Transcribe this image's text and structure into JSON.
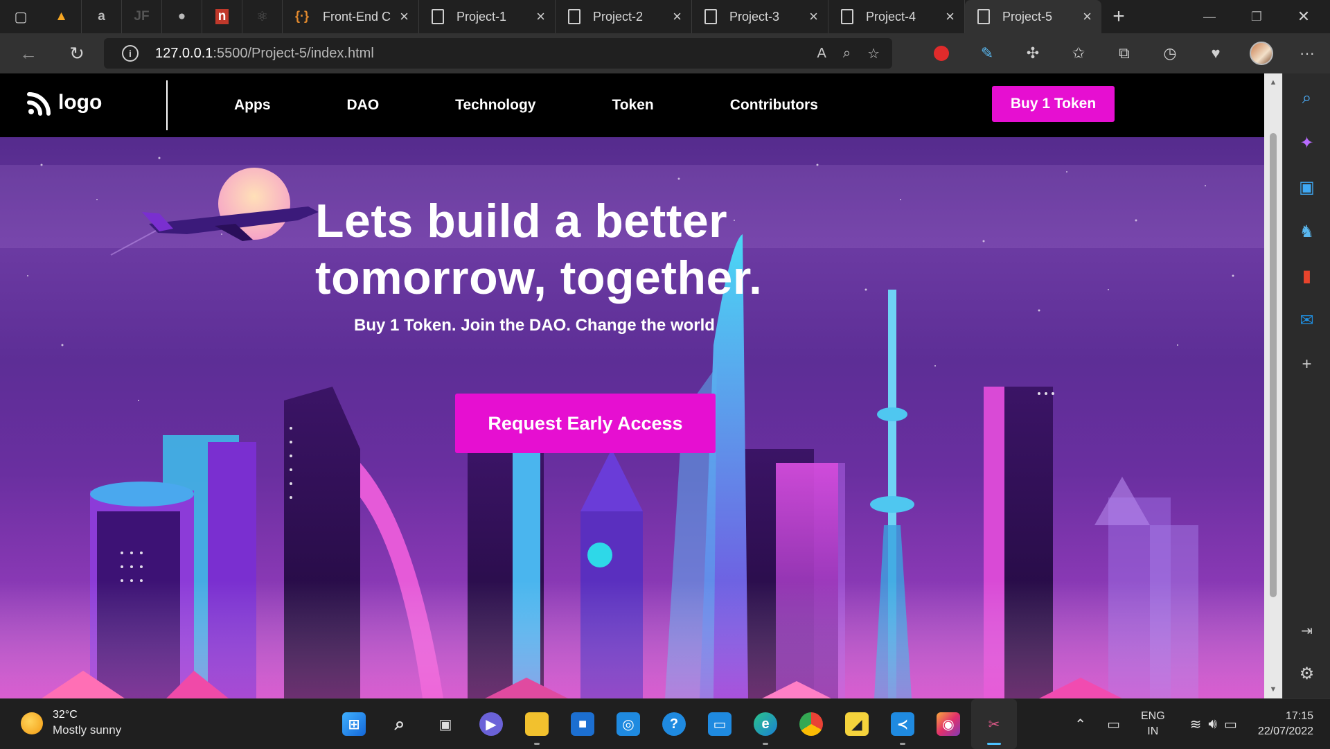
{
  "browser": {
    "tabs": [
      {
        "title": "Front-End C",
        "favicon": "code-braces-icon"
      },
      {
        "title": "Project-1",
        "favicon": "page-icon"
      },
      {
        "title": "Project-2",
        "favicon": "page-icon"
      },
      {
        "title": "Project-3",
        "favicon": "page-icon"
      },
      {
        "title": "Project-4",
        "favicon": "page-icon"
      },
      {
        "title": "Project-5",
        "favicon": "page-icon",
        "active": true
      }
    ],
    "url_host": "127.0.0.1",
    "url_rest": ":5500/Project-5/index.html"
  },
  "site": {
    "logo_text": "logo",
    "nav": [
      "Apps",
      "DAO",
      "Technology",
      "Token",
      "Contributors"
    ],
    "buy_label": "Buy 1 Token",
    "hero_title_line1": "Lets build a better",
    "hero_title_line2": "tomorrow, together.",
    "hero_subtitle": "Buy 1 Token. Join the DAO. Change the world",
    "cta_label": "Request Early Access",
    "accent_color": "#e60fd1"
  },
  "taskbar": {
    "temperature": "32°C",
    "weather": "Mostly sunny",
    "lang_line1": "ENG",
    "lang_line2": "IN",
    "time": "17:15",
    "date": "22/07/2022"
  }
}
